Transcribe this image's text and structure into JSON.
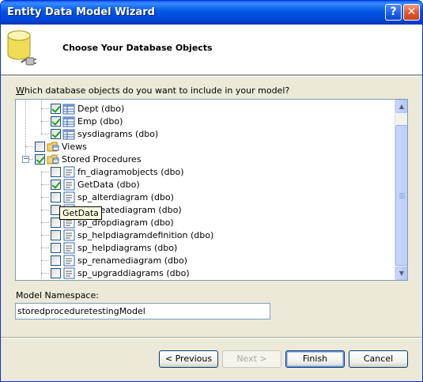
{
  "window": {
    "title": "Entity Data Model Wizard"
  },
  "titlebar": {
    "help_label": "?",
    "close_label": "✕"
  },
  "header": {
    "title": "Choose Your Database Objects"
  },
  "question": {
    "prefix": "",
    "mnemonic": "W",
    "rest": "hich database objects do you want to include in your model?"
  },
  "tree": {
    "items": [
      {
        "label": "Dept (dbo)",
        "checked": true,
        "kind": "table"
      },
      {
        "label": "Emp (dbo)",
        "checked": true,
        "kind": "table"
      },
      {
        "label": "sysdiagrams (dbo)",
        "checked": true,
        "kind": "table"
      },
      {
        "label": "Views",
        "checked": false,
        "kind": "folder"
      },
      {
        "label": "Stored Procedures",
        "checked": true,
        "kind": "folder"
      },
      {
        "label": "fn_diagramobjects (dbo)",
        "checked": false,
        "kind": "proc"
      },
      {
        "label": "GetData (dbo)",
        "checked": true,
        "kind": "proc"
      },
      {
        "label": "sp_alterdiagram (dbo)",
        "checked": false,
        "kind": "proc"
      },
      {
        "label": "sp_creatediagram (dbo)",
        "checked": false,
        "kind": "proc"
      },
      {
        "label": "sp_dropdiagram (dbo)",
        "checked": false,
        "kind": "proc"
      },
      {
        "label": "sp_helpdiagramdefinition (dbo)",
        "checked": false,
        "kind": "proc"
      },
      {
        "label": "sp_helpdiagrams (dbo)",
        "checked": false,
        "kind": "proc"
      },
      {
        "label": "sp_renamediagram (dbo)",
        "checked": false,
        "kind": "proc"
      },
      {
        "label": "sp_upgraddiagrams (dbo)",
        "checked": false,
        "kind": "proc"
      }
    ],
    "tooltip": "GetData"
  },
  "namespace": {
    "label": "Model Namespace:",
    "value": "storedproceduretestingModel"
  },
  "buttons": {
    "previous": "< Previous",
    "next": "Next >",
    "finish": "Finish",
    "cancel": "Cancel"
  },
  "colors": {
    "titlebar": "#0055e5",
    "dialog_bg": "#ece9d8",
    "check": "#21a121"
  },
  "icons": {
    "table": "table-icon",
    "folder": "folder-icon",
    "proc": "stored-procedure-icon",
    "header": "database-plug-icon"
  }
}
